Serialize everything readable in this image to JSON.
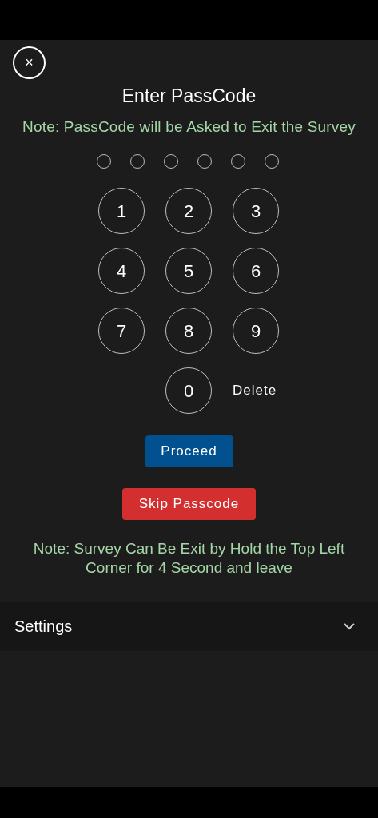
{
  "passcode_dialog": {
    "close": "×",
    "title": "Enter PassCode",
    "note": "Note: PassCode will be Asked to Exit the Survey",
    "pin_dots": [
      {
        "filled": false
      },
      {
        "filled": false
      },
      {
        "filled": false
      },
      {
        "filled": false
      },
      {
        "filled": false
      },
      {
        "filled": false
      }
    ],
    "keys": [
      "1",
      "2",
      "3",
      "4",
      "5",
      "6",
      "7",
      "8",
      "9",
      "0"
    ],
    "delete": "Delete",
    "proceed": "Proceed",
    "skip": "Skip Passcode",
    "exit_note": "Note: Survey Can Be Exit by Hold the Top Left Corner for 4 Second and leave"
  },
  "settings": {
    "label": "Settings",
    "expanded": false
  }
}
